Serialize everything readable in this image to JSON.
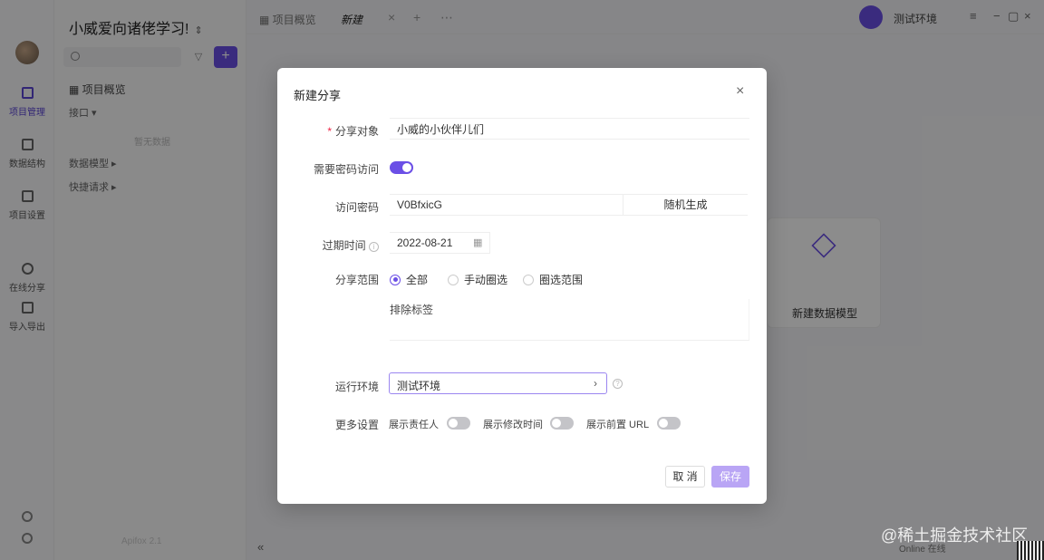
{
  "app": {
    "workspace_title": "小威爱向诸佬学习!",
    "rail": [
      {
        "label": "项目管理",
        "active": true
      },
      {
        "label": "数据结构",
        "active": false
      },
      {
        "label": "项目设置",
        "active": false
      },
      {
        "label": "在线分享",
        "active": false
      },
      {
        "label": "导入导出",
        "active": false
      }
    ],
    "tree": [
      {
        "label": "项目概览"
      },
      {
        "label": "接口"
      },
      {
        "label": "数据模型"
      },
      {
        "label": "快捷请求"
      }
    ],
    "empty_hint": "暂无数据",
    "sidebar_footer": "Apifox 2.1",
    "tabs": [
      {
        "label": "项目概览"
      },
      {
        "label": "新建"
      }
    ],
    "env_name": "测试环境",
    "empty_card_label": "新建数据模型",
    "status_text": "Online 在线"
  },
  "modal": {
    "title": "新建分享",
    "share_target": {
      "label": "分享对象",
      "value": "小威的小伙伴儿们"
    },
    "need_password": {
      "label": "需要密码访问",
      "on": true
    },
    "password": {
      "label": "访问密码",
      "value": "V0BfxicG",
      "generate": "随机生成"
    },
    "expire": {
      "label": "过期时间",
      "value": "2022-08-21"
    },
    "scope": {
      "label": "分享范围",
      "options": [
        {
          "label": "全部",
          "selected": true
        },
        {
          "label": "手动圈选",
          "selected": false
        },
        {
          "label": "圈选范围",
          "selected": false
        }
      ]
    },
    "exclude_tags": {
      "placeholder": "排除标签"
    },
    "runtime_env": {
      "label": "运行环境",
      "value": "测试环境"
    },
    "more": {
      "label": "更多设置",
      "items": [
        {
          "label": "展示责任人",
          "on": false
        },
        {
          "label": "展示修改时间",
          "on": false
        },
        {
          "label": "展示前置 URL",
          "on": false
        }
      ]
    },
    "cancel_label": "取 消",
    "save_label": "保存"
  },
  "watermark": "@稀土掘金技术社区",
  "colors": {
    "accent": "#6b4fe6",
    "accent_light": "#b9a5f5",
    "required": "#e24444"
  }
}
